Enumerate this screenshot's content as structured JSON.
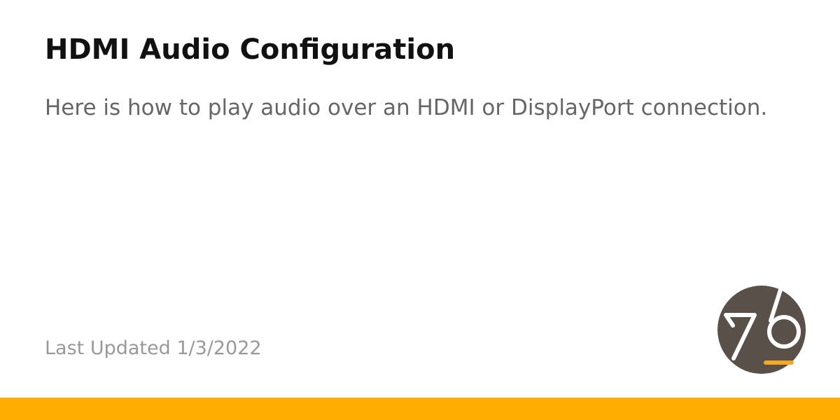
{
  "title": "HDMI Audio Configuration",
  "subtitle": "Here is how to play audio over an HDMI or DisplayPort connection.",
  "last_updated": "Last Updated 1/3/2022",
  "logo": {
    "text": "76",
    "circle_color": "#585049",
    "accent_color": "#f6a821"
  },
  "footer_bar_color": "#ffad00"
}
